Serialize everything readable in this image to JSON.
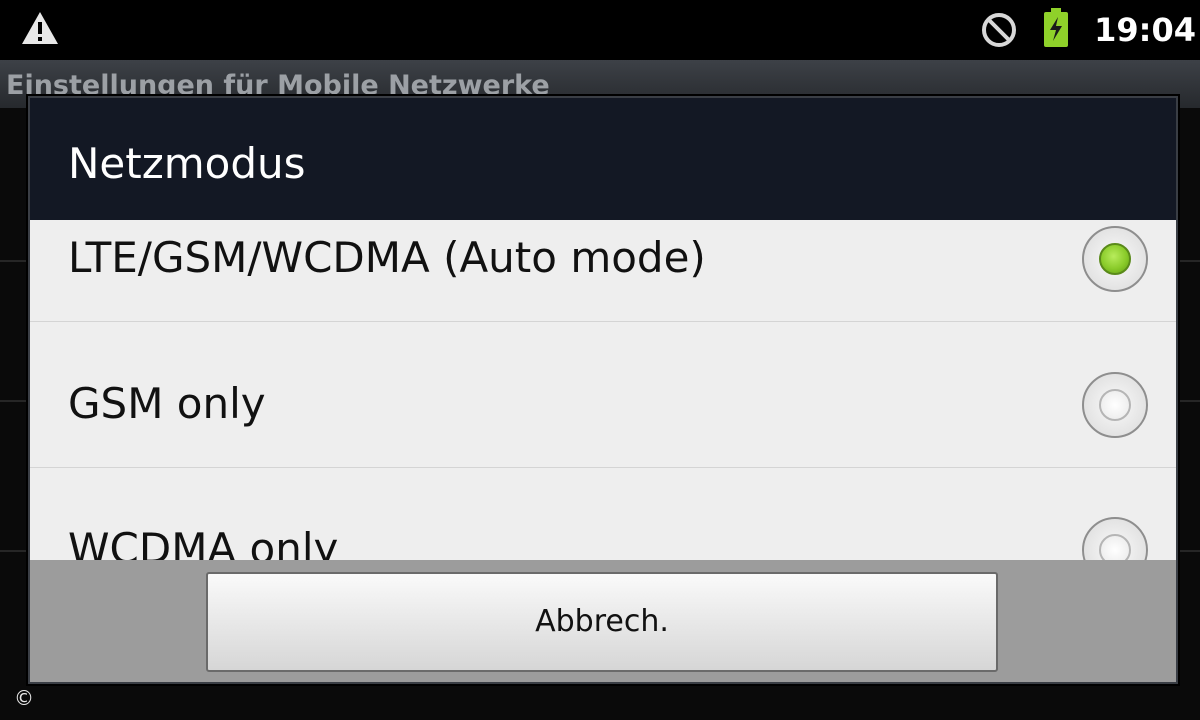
{
  "status_bar": {
    "time": "19:04",
    "icons": [
      "warning-icon",
      "blocked-icon",
      "battery-charging-icon"
    ],
    "battery_color": "#8fd12a"
  },
  "background": {
    "title": "Einstellungen für Mobile Netzwerke"
  },
  "dialog": {
    "title": "Netzmodus",
    "options": [
      {
        "label": "LTE/GSM/WCDMA (Auto mode)",
        "selected": true
      },
      {
        "label": "GSM only",
        "selected": false
      },
      {
        "label": "WCDMA only",
        "selected": false
      }
    ],
    "cancel_label": "Abbrech."
  },
  "footer": {
    "copyright": "©"
  },
  "colors": {
    "accent_selected": "#8acb2a",
    "dialog_header": "#131824",
    "list_background": "#eeeeee"
  }
}
